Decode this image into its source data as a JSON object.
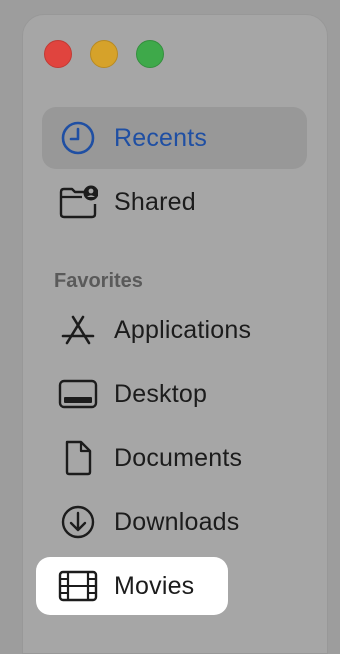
{
  "window": {
    "traffic_lights": [
      {
        "name": "close",
        "color": "#e0443e"
      },
      {
        "name": "minimize",
        "color": "#d6a22a"
      },
      {
        "name": "zoom",
        "color": "#3ea94a"
      }
    ]
  },
  "sidebar": {
    "top_items": [
      {
        "label": "Recents",
        "icon": "clock-icon",
        "selected": true
      },
      {
        "label": "Shared",
        "icon": "shared-folder-icon",
        "selected": false
      }
    ],
    "favorites_title": "Favorites",
    "favorites": [
      {
        "label": "Applications",
        "icon": "app-store-icon"
      },
      {
        "label": "Desktop",
        "icon": "desktop-icon"
      },
      {
        "label": "Documents",
        "icon": "document-icon"
      },
      {
        "label": "Downloads",
        "icon": "download-icon"
      },
      {
        "label": "Movies",
        "icon": "film-icon",
        "highlighted": true
      }
    ]
  },
  "colors": {
    "selected_text": "#1f4fa3",
    "highlight_bg": "#ffffff"
  }
}
